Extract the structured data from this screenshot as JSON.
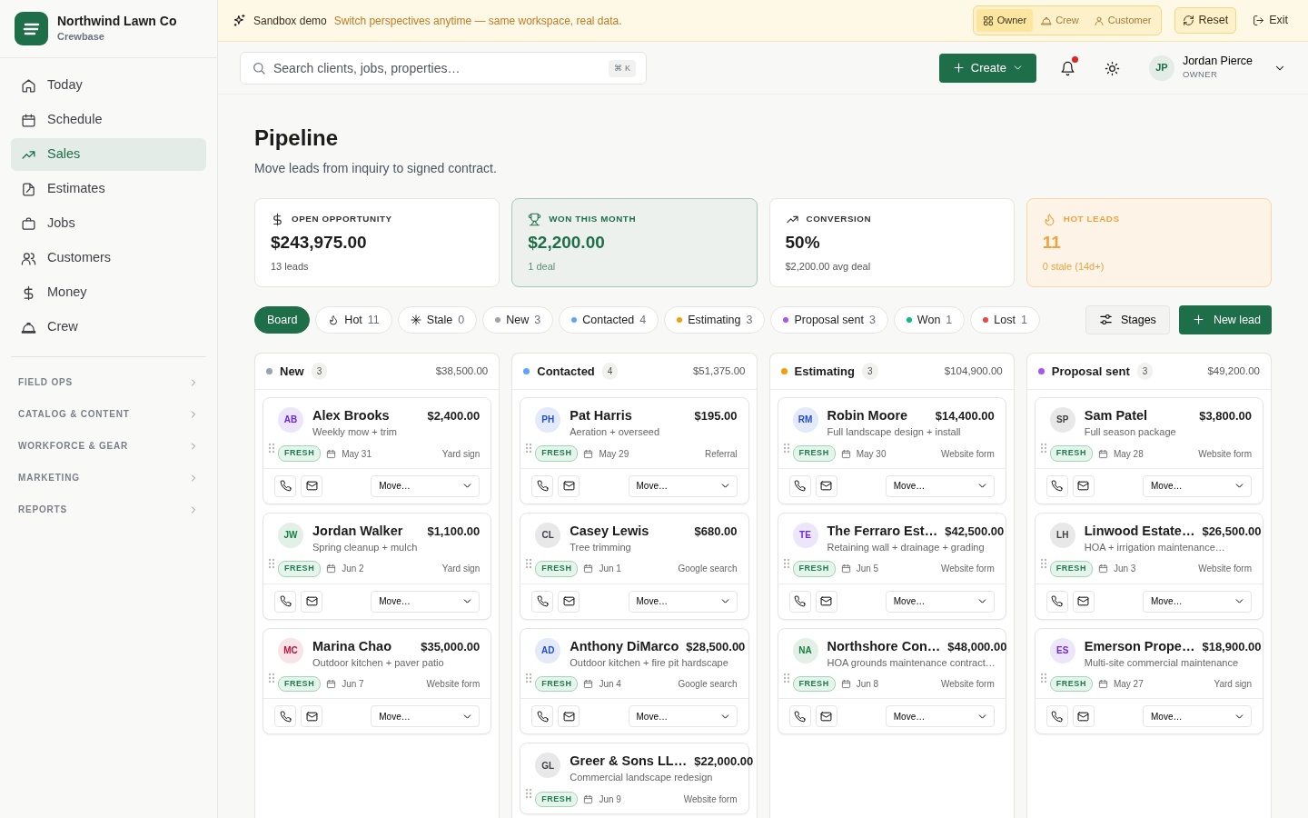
{
  "sidebar": {
    "brand": {
      "name": "Northwind Lawn Co",
      "subtitle": "Crewbase"
    },
    "nav": [
      {
        "label": "Today",
        "selected": false
      },
      {
        "label": "Schedule",
        "selected": false
      },
      {
        "label": "Sales",
        "selected": true
      },
      {
        "label": "Estimates",
        "selected": false
      },
      {
        "label": "Jobs",
        "selected": false
      },
      {
        "label": "Customers",
        "selected": false
      },
      {
        "label": "Money",
        "selected": false
      },
      {
        "label": "Crew",
        "selected": false
      }
    ],
    "sections": [
      {
        "label": "FIELD OPS",
        "expanded": false
      },
      {
        "label": "CATALOG & CONTENT",
        "expanded": false
      },
      {
        "label": "WORKFORCE & GEAR",
        "expanded": false
      },
      {
        "label": "MARKETING",
        "expanded": false
      },
      {
        "label": "REPORTS",
        "expanded": false
      }
    ]
  },
  "banner": {
    "title": "Sandbox demo",
    "message": "Switch perspectives anytime — same workspace, real data.",
    "perspectives": [
      {
        "label": "Owner",
        "selected": true
      },
      {
        "label": "Crew",
        "selected": false
      },
      {
        "label": "Customer",
        "selected": false
      }
    ],
    "reset": "Reset",
    "exit": "Exit"
  },
  "header": {
    "search": {
      "placeholder": "Search clients, jobs, properties…",
      "shortcut": "⌘ K"
    },
    "create": "Create",
    "notifications": {
      "unread": true
    },
    "user": {
      "initials": "JP",
      "name": "Jordan Pierce",
      "role": "OWNER"
    }
  },
  "page": {
    "title": "Pipeline",
    "subtitle": "Move leads from inquiry to signed contract."
  },
  "stats": [
    {
      "kind": "neutral",
      "label": "OPEN OPPORTUNITY",
      "value": "$243,975.00",
      "note": "13 leads"
    },
    {
      "kind": "success",
      "label": "WON THIS MONTH",
      "value": "$2,200.00",
      "note": "1 deal"
    },
    {
      "kind": "neutral",
      "label": "CONVERSION",
      "value": "50%",
      "note": "$2,200.00 avg deal"
    },
    {
      "kind": "warning",
      "label": "HOT LEADS",
      "value": "11",
      "note": "0 stale (14d+)"
    }
  ],
  "filters": [
    {
      "kind": "plain",
      "label": "Board",
      "selected": true
    },
    {
      "kind": "hot",
      "label": "Hot",
      "count": "11",
      "selected": false
    },
    {
      "kind": "stale",
      "label": "Stale",
      "count": "0",
      "selected": false
    },
    {
      "kind": "stage",
      "label": "New",
      "count": "3",
      "color": "#9ca3af",
      "selected": false
    },
    {
      "kind": "stage",
      "label": "Contacted",
      "count": "4",
      "color": "#60a5fa",
      "selected": false
    },
    {
      "kind": "stage",
      "label": "Estimating",
      "count": "3",
      "color": "#f59e0b",
      "selected": false
    },
    {
      "kind": "stage",
      "label": "Proposal sent",
      "count": "3",
      "color": "#a855f7",
      "selected": false
    },
    {
      "kind": "stage",
      "label": "Won",
      "count": "1",
      "color": "#10b981",
      "selected": false
    },
    {
      "kind": "stage",
      "label": "Lost",
      "count": "1",
      "color": "#ef4444",
      "selected": false
    }
  ],
  "toolbar": {
    "stages": "Stages",
    "new_lead": "New lead"
  },
  "columns": [
    {
      "name": "New",
      "color": "#9ca3af",
      "count": "3",
      "total": "$38,500.00",
      "cards": [
        {
          "initials": "AB",
          "color": "#6d28d9",
          "name": "Alex Brooks",
          "amount": "$2,400.00",
          "service": "Weekly mow + trim",
          "tag": "FRESH",
          "date": "May 31",
          "source": "Yard sign",
          "move": "Move…"
        },
        {
          "initials": "JW",
          "color": "#15803d",
          "name": "Jordan Walker",
          "amount": "$1,100.00",
          "service": "Spring cleanup + mulch",
          "tag": "FRESH",
          "date": "Jun 2",
          "source": "Yard sign",
          "move": "Move…"
        },
        {
          "initials": "MC",
          "color": "#be123c",
          "name": "Marina Chao",
          "amount": "$35,000.00",
          "service": "Outdoor kitchen + paver patio",
          "tag": "FRESH",
          "date": "Jun 7",
          "source": "Website form",
          "move": "Move…"
        }
      ]
    },
    {
      "name": "Contacted",
      "color": "#60a5fa",
      "count": "4",
      "total": "$51,375.00",
      "cards": [
        {
          "initials": "PH",
          "color": "#1d4ed8",
          "name": "Pat Harris",
          "amount": "$195.00",
          "service": "Aeration + overseed",
          "tag": "FRESH",
          "date": "May 29",
          "source": "Referral",
          "move": "Move…"
        },
        {
          "initials": "CL",
          "color": "#3f3f46",
          "name": "Casey Lewis",
          "amount": "$680.00",
          "service": "Tree trimming",
          "tag": "FRESH",
          "date": "Jun 1",
          "source": "Google search",
          "move": "Move…"
        },
        {
          "initials": "AD",
          "color": "#1d4ed8",
          "name": "Anthony DiMarco",
          "amount": "$28,500.00",
          "service": "Outdoor kitchen + fire pit hardscape",
          "tag": "FRESH",
          "date": "Jun 4",
          "source": "Google search",
          "move": "Move…"
        },
        {
          "initials": "GL",
          "color": "#3f3f46",
          "name": "Greer & Sons LL…",
          "amount": "$22,000.00",
          "service": "Commercial landscape redesign",
          "tag": "FRESH",
          "date": "Jun 9",
          "source": "Website form"
        }
      ]
    },
    {
      "name": "Estimating",
      "color": "#f59e0b",
      "count": "3",
      "total": "$104,900.00",
      "cards": [
        {
          "initials": "RM",
          "color": "#1d4ed8",
          "name": "Robin Moore",
          "amount": "$14,400.00",
          "service": "Full landscape design + install",
          "tag": "FRESH",
          "date": "May 30",
          "source": "Website form",
          "move": "Move…"
        },
        {
          "initials": "TE",
          "color": "#6d28d9",
          "name": "The Ferraro Est…",
          "amount": "$42,500.00",
          "service": "Retaining wall + drainage + grading",
          "tag": "FRESH",
          "date": "Jun 5",
          "source": "Website form",
          "move": "Move…"
        },
        {
          "initials": "NA",
          "color": "#15803d",
          "name": "Northshore Con…",
          "amount": "$48,000.00",
          "service": "HOA grounds maintenance contract…",
          "tag": "FRESH",
          "date": "Jun 8",
          "source": "Website form",
          "move": "Move…"
        }
      ]
    },
    {
      "name": "Proposal sent",
      "color": "#a855f7",
      "count": "3",
      "total": "$49,200.00",
      "cards": [
        {
          "initials": "SP",
          "color": "#3f3f46",
          "name": "Sam Patel",
          "amount": "$3,800.00",
          "service": "Full season package",
          "tag": "FRESH",
          "date": "May 28",
          "source": "Website form",
          "move": "Move…"
        },
        {
          "initials": "LH",
          "color": "#3f3f46",
          "name": "Linwood Estate…",
          "amount": "$26,500.00",
          "service": "HOA + irrigation maintenance…",
          "tag": "FRESH",
          "date": "Jun 3",
          "source": "Website form",
          "move": "Move…"
        },
        {
          "initials": "ES",
          "color": "#6d28d9",
          "name": "Emerson Prope…",
          "amount": "$18,900.00",
          "service": "Multi-site commercial maintenance",
          "tag": "FRESH",
          "date": "May 27",
          "source": "Yard sign",
          "move": "Move…"
        }
      ]
    }
  ]
}
